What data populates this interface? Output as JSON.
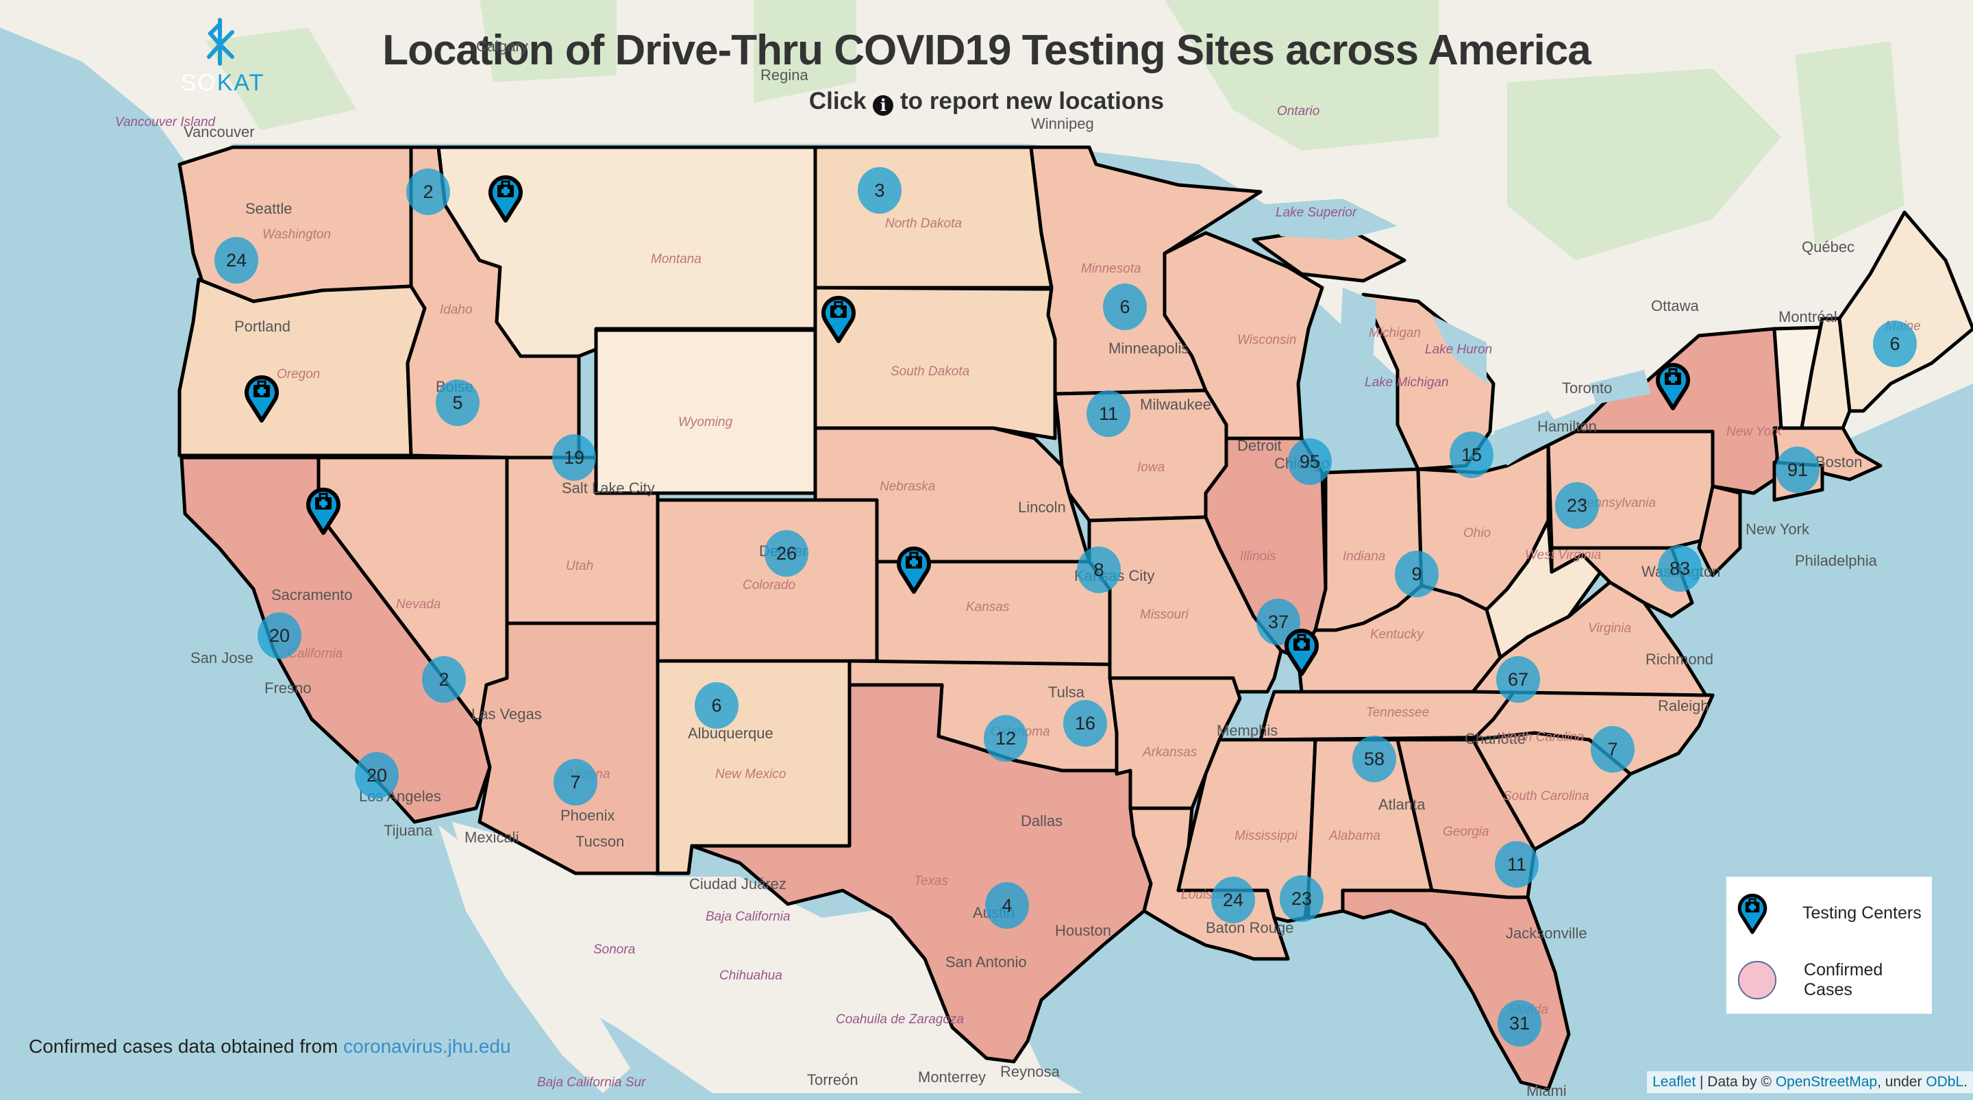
{
  "header": {
    "title": "Location of Drive-Thru COVID19 Testing Sites across America",
    "subtitle_before": "Click",
    "subtitle_after": "to report new locations",
    "info_icon": "i"
  },
  "logo": {
    "prefix": "SO",
    "suffix": "KAT",
    "icon": "sokat-logo-icon"
  },
  "colors": {
    "water": "#aad3df",
    "land": "#f2efe9",
    "cluster": "#1ea0d2",
    "marker_fill": "#0a9ad6",
    "state_high": "#e9a598",
    "state_mid": "#f4c3ad",
    "state_low": "#f6d8bd",
    "state_lowest": "#f8e7d3",
    "legend_circle": "#f4c1cc"
  },
  "legend": {
    "items": [
      {
        "label": "Testing Centers",
        "icon": "testing-center-marker-icon"
      },
      {
        "label": "Confirmed Cases",
        "icon": "confirmed-cases-circle-icon"
      }
    ]
  },
  "source": {
    "text": "Confirmed cases data obtained from",
    "link": "coronavirus.jhu.edu"
  },
  "attribution": {
    "leaflet": "Leaflet",
    "sep": " | Data by © ",
    "osm": "OpenStreetMap",
    "under": ", under ",
    "odbl": "ODbL",
    "end": "."
  },
  "clusters": [
    {
      "region": "Washington West",
      "count": "24"
    },
    {
      "region": "Idaho North",
      "count": "2"
    },
    {
      "region": "Idaho",
      "count": "5"
    },
    {
      "region": "Utah North",
      "count": "19"
    },
    {
      "region": "California North",
      "count": "20"
    },
    {
      "region": "California South",
      "count": "20"
    },
    {
      "region": "Nevada South",
      "count": "2"
    },
    {
      "region": "Arizona",
      "count": "7"
    },
    {
      "region": "New Mexico",
      "count": "6"
    },
    {
      "region": "Colorado",
      "count": "26"
    },
    {
      "region": "North Dakota",
      "count": "3"
    },
    {
      "region": "Minnesota",
      "count": "6"
    },
    {
      "region": "Iowa",
      "count": "11"
    },
    {
      "region": "Kansas City",
      "count": "8"
    },
    {
      "region": "Oklahoma West",
      "count": "12"
    },
    {
      "region": "Oklahoma East",
      "count": "16"
    },
    {
      "region": "Texas",
      "count": "4"
    },
    {
      "region": "Illinois North",
      "count": "95"
    },
    {
      "region": "Illinois South",
      "count": "37"
    },
    {
      "region": "Indiana South",
      "count": "9"
    },
    {
      "region": "Michigan",
      "count": "15"
    },
    {
      "region": "Pennsylvania",
      "count": "23"
    },
    {
      "region": "Maryland",
      "count": "83"
    },
    {
      "region": "Connecticut",
      "count": "91"
    },
    {
      "region": "Maine",
      "count": "6"
    },
    {
      "region": "Virginia South",
      "count": "67"
    },
    {
      "region": "North Carolina",
      "count": "7"
    },
    {
      "region": "Alabama",
      "count": "58"
    },
    {
      "region": "Louisiana",
      "count": "24"
    },
    {
      "region": "Mississippi Coast",
      "count": "23"
    },
    {
      "region": "Georgia Coast",
      "count": "11"
    },
    {
      "region": "Florida",
      "count": "31"
    }
  ],
  "markers": [
    {
      "region": "Montana West"
    },
    {
      "region": "Oregon"
    },
    {
      "region": "Nevada West"
    },
    {
      "region": "South Dakota West"
    },
    {
      "region": "Kansas"
    },
    {
      "region": "Tennessee West"
    },
    {
      "region": "New York"
    }
  ],
  "cities": [
    "Calgary",
    "Regina",
    "Winnipeg",
    "Vancouver",
    "Seattle",
    "Portland",
    "Boise",
    "Salt Lake City",
    "Sacramento",
    "San Jose",
    "Fresno",
    "Las Vegas",
    "Los Angeles",
    "Tijuana",
    "Mexicali",
    "Phoenix",
    "Tucson",
    "Albuquerque",
    "Denver",
    "Ciudad Juárez",
    "Dallas",
    "Houston",
    "San Antonio",
    "Austin",
    "Tulsa",
    "Lincoln",
    "Kansas City",
    "Minneapolis",
    "Milwaukee",
    "Chicago",
    "Detroit",
    "Toronto",
    "Hamilton",
    "Ottawa",
    "Montréal",
    "Québec",
    "Boston",
    "New York",
    "Philadelphia",
    "Washington",
    "Richmond",
    "Raleigh",
    "Charlotte",
    "Atlanta",
    "Jacksonville",
    "Miami",
    "Memphis",
    "Baton Rouge",
    "Monterrey",
    "Torreón",
    "Reynosa"
  ],
  "state_labels": [
    "Washington",
    "Oregon",
    "Idaho",
    "Montana",
    "Wyoming",
    "Nevada",
    "California",
    "Utah",
    "Arizona",
    "Colorado",
    "New Mexico",
    "North Dakota",
    "South Dakota",
    "Nebraska",
    "Kansas",
    "Oklahoma",
    "Texas",
    "Minnesota",
    "Iowa",
    "Missouri",
    "Arkansas",
    "Louisiana",
    "Wisconsin",
    "Illinois",
    "Michigan",
    "Indiana",
    "Ohio",
    "Kentucky",
    "Tennessee",
    "Mississippi",
    "Alabama",
    "Georgia",
    "Florida",
    "South Carolina",
    "North Carolina",
    "Virginia",
    "West Virginia",
    "Pennsylvania",
    "New York",
    "Maine"
  ],
  "region_labels": [
    "Vancouver Island",
    "Ontario",
    "Lake Superior",
    "Lake Michigan",
    "Lake Huron",
    "Baja California",
    "Sonora",
    "Chihuahua",
    "Coahuila de Zaragoza",
    "Baja California Sur"
  ]
}
